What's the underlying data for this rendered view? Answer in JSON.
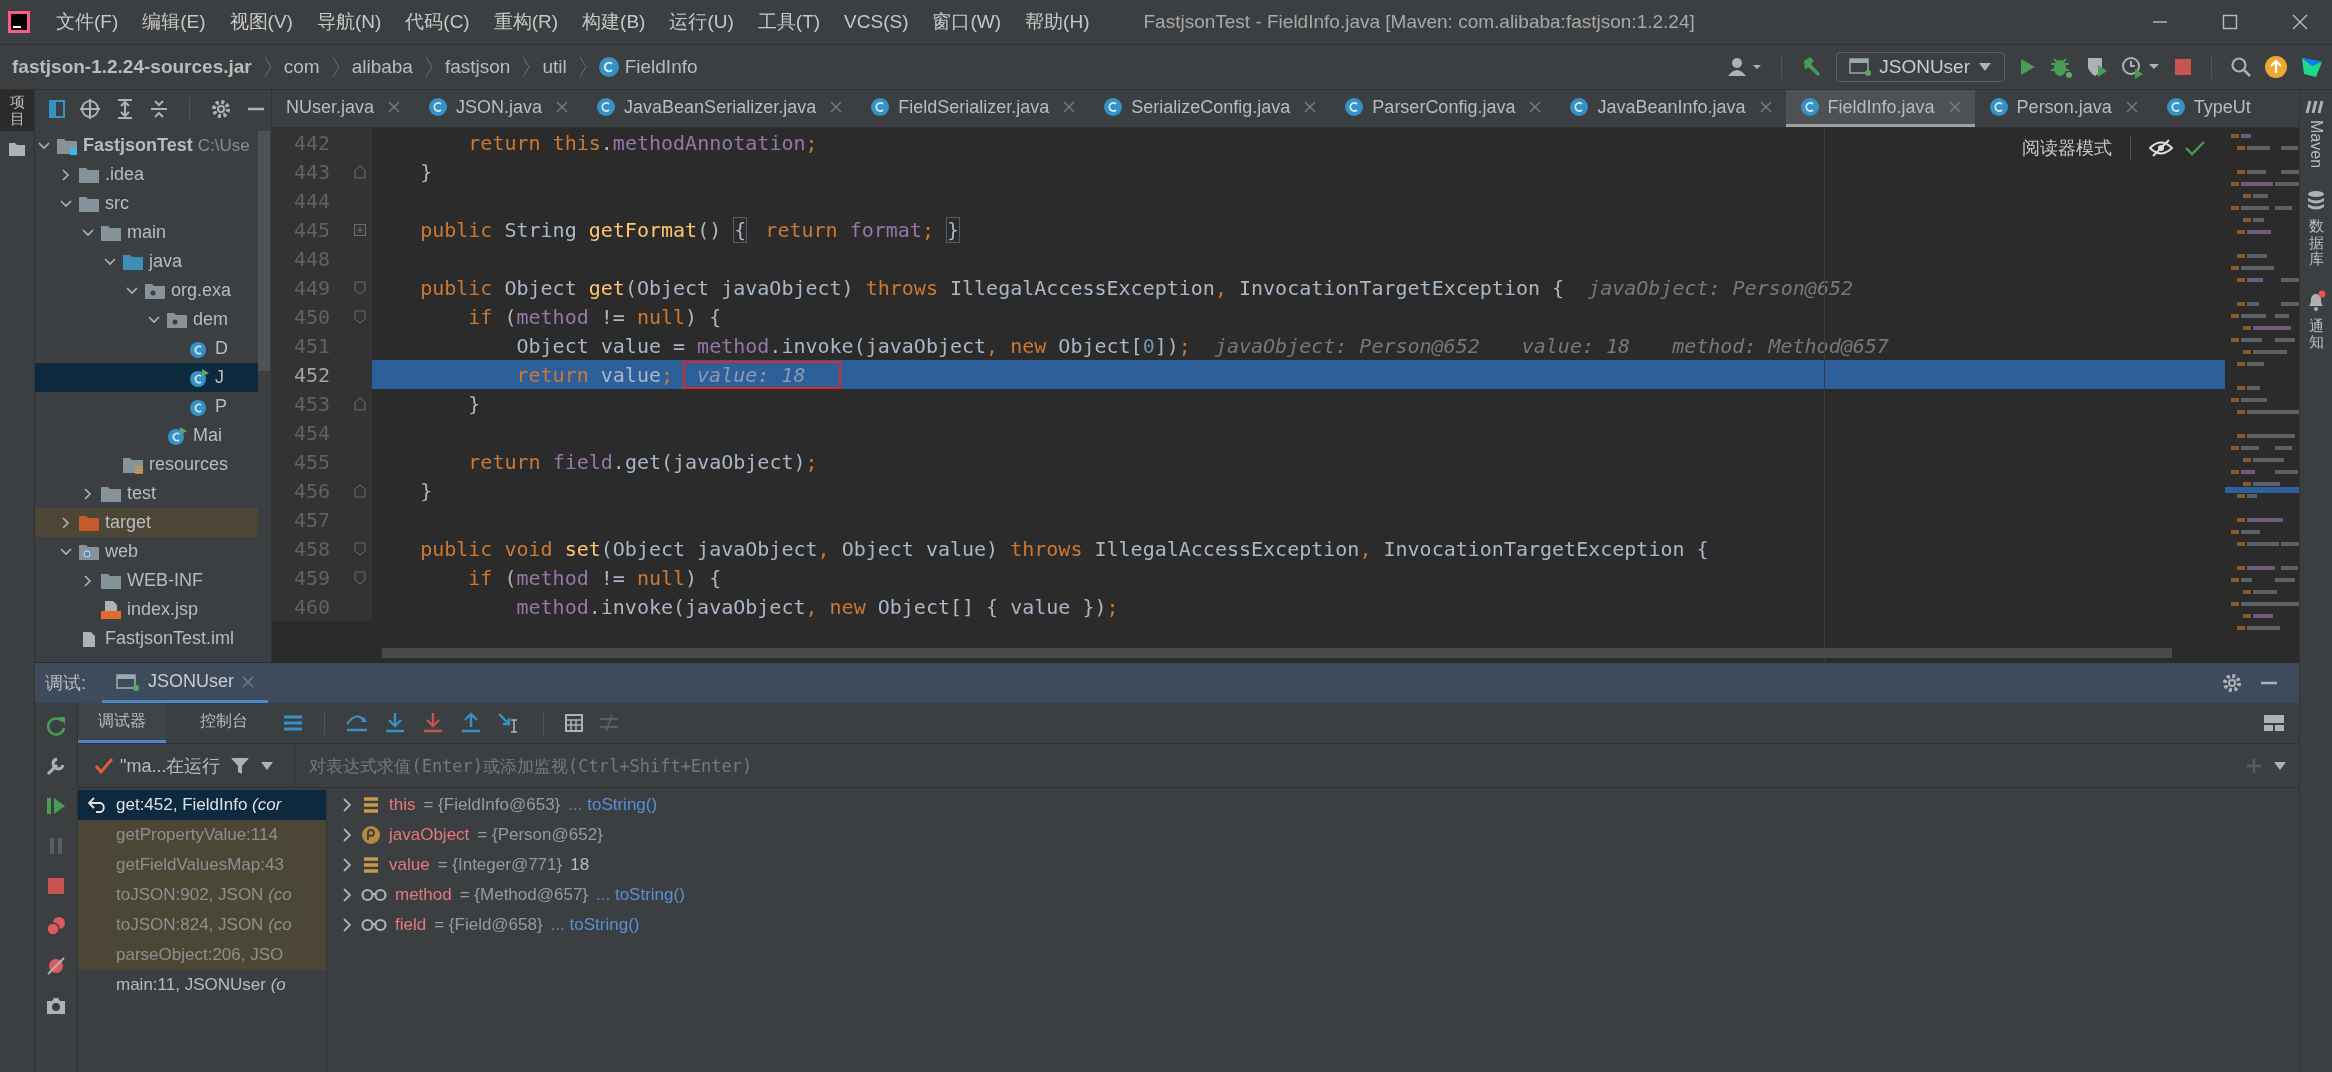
{
  "window": {
    "title": "FastjsonTest - FieldInfo.java [Maven: com.alibaba:fastjson:1.2.24]"
  },
  "menu": [
    "文件(F)",
    "编辑(E)",
    "视图(V)",
    "导航(N)",
    "代码(C)",
    "重构(R)",
    "构建(B)",
    "运行(U)",
    "工具(T)",
    "VCS(S)",
    "窗口(W)",
    "帮助(H)"
  ],
  "breadcrumb": [
    {
      "label": "fastjson-1.2.24-sources.jar",
      "kind": "jar"
    },
    {
      "label": "com",
      "kind": "package"
    },
    {
      "label": "alibaba",
      "kind": "package"
    },
    {
      "label": "fastjson",
      "kind": "package"
    },
    {
      "label": "util",
      "kind": "package"
    },
    {
      "label": "FieldInfo",
      "kind": "class"
    }
  ],
  "run_config": {
    "label": "JSONUser"
  },
  "left_stripe": {
    "label": "项目"
  },
  "right_stripe": [
    {
      "label": "Maven",
      "kind": "maven"
    },
    {
      "label": "数据库",
      "kind": "database"
    },
    {
      "label": "通知",
      "kind": "notifications"
    }
  ],
  "project": {
    "tree": [
      {
        "label": "FastjsonTest",
        "path": "C:\\Use",
        "kind": "module",
        "expanded": true,
        "selected": false,
        "children": [
          {
            "label": ".idea",
            "kind": "folder",
            "expanded": false,
            "selected": false
          },
          {
            "label": "src",
            "kind": "folder",
            "expanded": true,
            "selected": false,
            "children": [
              {
                "label": "main",
                "kind": "folder",
                "expanded": true,
                "selected": false,
                "children": [
                  {
                    "label": "java",
                    "kind": "source-folder",
                    "expanded": true,
                    "selected": false,
                    "children": [
                      {
                        "label": "org.exa",
                        "kind": "package",
                        "expanded": true,
                        "selected": false,
                        "children": [
                          {
                            "label": "dem",
                            "kind": "package",
                            "expanded": true,
                            "selected": false,
                            "children": [
                              {
                                "label": "D",
                                "kind": "class",
                                "selected": false
                              },
                              {
                                "label": "J",
                                "kind": "main-class",
                                "selected": true
                              },
                              {
                                "label": "P",
                                "kind": "class",
                                "selected": false
                              }
                            ]
                          },
                          {
                            "label": "Mai",
                            "kind": "main-class",
                            "selected": false
                          }
                        ]
                      }
                    ]
                  },
                  {
                    "label": "resources",
                    "kind": "resources-folder",
                    "selected": false
                  }
                ]
              },
              {
                "label": "test",
                "kind": "folder",
                "expanded": false,
                "selected": false
              }
            ]
          },
          {
            "label": "target",
            "kind": "excluded-folder",
            "expanded": false,
            "selected": false
          },
          {
            "label": "web",
            "kind": "web-folder",
            "expanded": true,
            "selected": false,
            "children": [
              {
                "label": "WEB-INF",
                "kind": "folder",
                "expanded": false,
                "selected": false
              },
              {
                "label": "index.jsp",
                "kind": "jsp",
                "selected": false
              }
            ]
          },
          {
            "label": "FastjsonTest.iml",
            "kind": "iml",
            "selected": false
          }
        ]
      }
    ]
  },
  "editor_tabs": [
    {
      "label": "NUser.java",
      "selected": false,
      "closable": true
    },
    {
      "label": "JSON.java",
      "selected": false,
      "closable": true
    },
    {
      "label": "JavaBeanSerializer.java",
      "selected": false,
      "closable": true
    },
    {
      "label": "FieldSerializer.java",
      "selected": false,
      "closable": true
    },
    {
      "label": "SerializeConfig.java",
      "selected": false,
      "closable": true
    },
    {
      "label": "ParserConfig.java",
      "selected": false,
      "closable": true
    },
    {
      "label": "JavaBeanInfo.java",
      "selected": false,
      "closable": true
    },
    {
      "label": "FieldInfo.java",
      "selected": true,
      "closable": true
    },
    {
      "label": "Person.java",
      "selected": false,
      "closable": true
    },
    {
      "label": "TypeUt",
      "selected": false,
      "closable": false
    }
  ],
  "editor": {
    "reader_mode": "阅读器模式",
    "lines": [
      {
        "number": "442",
        "current": false,
        "kind": "plain",
        "tokens": [
          {
            "text": "        return ",
            "kind": "kw"
          },
          {
            "text": "this",
            "kind": "kw"
          },
          {
            "text": ".",
            "kind": "plain"
          },
          {
            "text": "methodAnnotation",
            "kind": "field"
          },
          {
            "text": ";",
            "kind": "kw"
          }
        ]
      },
      {
        "number": "443",
        "current": false,
        "kind": "fold-end",
        "tokens": [
          {
            "text": "    }",
            "kind": "plain"
          }
        ]
      },
      {
        "number": "444",
        "current": false,
        "kind": "plain"
      },
      {
        "number": "445",
        "current": false,
        "kind": "folded",
        "tokens": [
          {
            "text": "    public ",
            "kind": "kw"
          },
          {
            "text": "String ",
            "kind": "plain"
          },
          {
            "text": "getFormat",
            "kind": "fn"
          },
          {
            "text": "() ",
            "kind": "plain"
          },
          {
            "text": "{",
            "kind": "fold"
          },
          {
            "text": " return ",
            "kind": "kw"
          },
          {
            "text": "format",
            "kind": "field"
          },
          {
            "text": "; ",
            "kind": "kw"
          },
          {
            "text": "}",
            "kind": "fold"
          }
        ]
      },
      {
        "number": "448",
        "current": false,
        "kind": "plain"
      },
      {
        "number": "449",
        "current": false,
        "kind": "fold-start",
        "tokens": [
          {
            "text": "    public ",
            "kind": "kw"
          },
          {
            "text": "Object ",
            "kind": "plain"
          },
          {
            "text": "get",
            "kind": "fn"
          },
          {
            "text": "(Object javaObject) ",
            "kind": "plain"
          },
          {
            "text": "throws ",
            "kind": "kw"
          },
          {
            "text": "IllegalAccessException",
            "kind": "plain"
          },
          {
            "text": ", ",
            "kind": "kw"
          },
          {
            "text": "InvocationTargetException {",
            "kind": "plain"
          }
        ],
        "hints": [
          {
            "text": "javaObject: Person@652",
            "boxed": false
          }
        ]
      },
      {
        "number": "450",
        "current": false,
        "kind": "fold-start",
        "tokens": [
          {
            "text": "        if ",
            "kind": "kw"
          },
          {
            "text": "(",
            "kind": "plain"
          },
          {
            "text": "method",
            "kind": "field"
          },
          {
            "text": " != ",
            "kind": "plain"
          },
          {
            "text": "null",
            "kind": "kw"
          },
          {
            "text": ") {",
            "kind": "plain"
          }
        ]
      },
      {
        "number": "451",
        "current": false,
        "kind": "plain",
        "tokens": [
          {
            "text": "            Object value = ",
            "kind": "plain"
          },
          {
            "text": "method",
            "kind": "field"
          },
          {
            "text": ".invoke(javaObject",
            "kind": "plain"
          },
          {
            "text": ", new ",
            "kind": "kw"
          },
          {
            "text": "Object[",
            "kind": "plain"
          },
          {
            "text": "0",
            "kind": "num"
          },
          {
            "text": "])",
            "kind": "plain"
          },
          {
            "text": ";",
            "kind": "kw"
          }
        ],
        "hints": [
          {
            "text": "javaObject: Person@652",
            "boxed": false
          },
          {
            "text": "value: 18",
            "boxed": false
          },
          {
            "text": "method: Method@657",
            "boxed": false
          }
        ]
      },
      {
        "number": "452",
        "current": true,
        "kind": "plain",
        "tokens": [
          {
            "text": "            return ",
            "kind": "kw"
          },
          {
            "text": "value",
            "kind": "plain"
          },
          {
            "text": ";",
            "kind": "kw"
          }
        ],
        "hints": [
          {
            "text": "value: 18",
            "boxed": true
          }
        ]
      },
      {
        "number": "453",
        "current": false,
        "kind": "fold-end",
        "tokens": [
          {
            "text": "        }",
            "kind": "plain"
          }
        ]
      },
      {
        "number": "454",
        "current": false,
        "kind": "plain"
      },
      {
        "number": "455",
        "current": false,
        "kind": "plain",
        "tokens": [
          {
            "text": "        return ",
            "kind": "kw"
          },
          {
            "text": "field",
            "kind": "field"
          },
          {
            "text": ".get(javaObject)",
            "kind": "plain"
          },
          {
            "text": ";",
            "kind": "kw"
          }
        ]
      },
      {
        "number": "456",
        "current": false,
        "kind": "fold-end",
        "tokens": [
          {
            "text": "    }",
            "kind": "plain"
          }
        ]
      },
      {
        "number": "457",
        "current": false,
        "kind": "plain"
      },
      {
        "number": "458",
        "current": false,
        "kind": "fold-start",
        "tokens": [
          {
            "text": "    public void ",
            "kind": "kw"
          },
          {
            "text": "set",
            "kind": "fn"
          },
          {
            "text": "(Object javaObject",
            "kind": "plain"
          },
          {
            "text": ", ",
            "kind": "kw"
          },
          {
            "text": "Object value) ",
            "kind": "plain"
          },
          {
            "text": "throws ",
            "kind": "kw"
          },
          {
            "text": "IllegalAccessException",
            "kind": "plain"
          },
          {
            "text": ", ",
            "kind": "kw"
          },
          {
            "text": "InvocationTargetException {",
            "kind": "plain"
          }
        ]
      },
      {
        "number": "459",
        "current": false,
        "kind": "fold-start",
        "tokens": [
          {
            "text": "        if ",
            "kind": "kw"
          },
          {
            "text": "(",
            "kind": "plain"
          },
          {
            "text": "method",
            "kind": "field"
          },
          {
            "text": " != ",
            "kind": "plain"
          },
          {
            "text": "null",
            "kind": "kw"
          },
          {
            "text": ") {",
            "kind": "plain"
          }
        ]
      },
      {
        "number": "460",
        "current": false,
        "kind": "plain",
        "tokens": [
          {
            "text": "            method",
            "kind": "field"
          },
          {
            "text": ".invoke(javaObject",
            "kind": "plain"
          },
          {
            "text": ", new ",
            "kind": "kw"
          },
          {
            "text": "Object[] { value })",
            "kind": "plain"
          },
          {
            "text": ";",
            "kind": "kw"
          }
        ]
      }
    ]
  },
  "debug": {
    "label": "调试:",
    "session_tab": {
      "label": "JSONUser"
    },
    "tabs": [
      {
        "label": "调试器",
        "selected": true
      },
      {
        "label": "控制台",
        "selected": false
      }
    ],
    "thread": {
      "label": "\"ma...在运行"
    },
    "evaluate": {
      "placeholder": "对表达式求值(Enter)或添加监视(Ctrl+Shift+Enter)"
    },
    "frames": [
      {
        "text": "get:452, FieldInfo *(cor*",
        "kind": "current",
        "selected": true
      },
      {
        "text": "getPropertyValue:114",
        "kind": "library",
        "selected": false
      },
      {
        "text": "getFieldValuesMap:43",
        "kind": "library",
        "selected": false
      },
      {
        "text": "toJSON:902, JSON *(co*",
        "kind": "library",
        "selected": false
      },
      {
        "text": "toJSON:824, JSON *(co*",
        "kind": "library",
        "selected": false
      },
      {
        "text": "parseObject:206, JSO",
        "kind": "library",
        "selected": false
      },
      {
        "text": "main:11, JSONUser *(o*",
        "kind": "user",
        "selected": false
      }
    ],
    "variables": [
      {
        "kind": "field",
        "name": "this",
        "value": "= {FieldInfo@653}",
        "link": "... toString()"
      },
      {
        "kind": "parameter",
        "name": "javaObject",
        "value": "= {Person@652}"
      },
      {
        "kind": "field",
        "name": "value",
        "value": "= {Integer@771}",
        "result": "18"
      },
      {
        "kind": "watch",
        "name": "method",
        "value": "= {Method@657}",
        "link": "... toString()"
      },
      {
        "kind": "watch",
        "name": "field",
        "value": "= {Field@658}",
        "link": "... toString()"
      }
    ]
  }
}
